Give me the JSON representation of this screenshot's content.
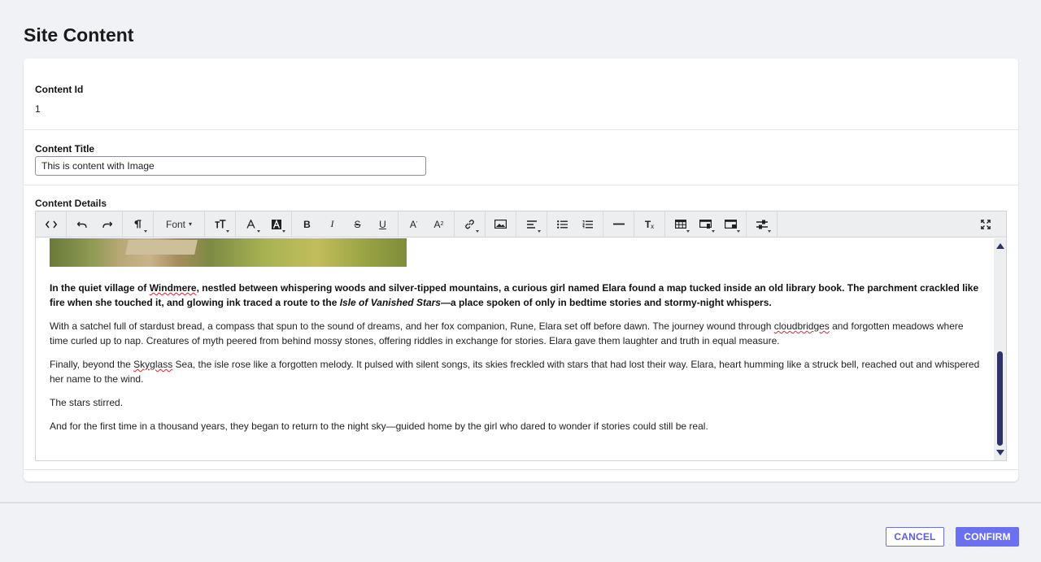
{
  "page": {
    "title": "Site Content"
  },
  "fields": {
    "content_id": {
      "label": "Content Id",
      "value": "1"
    },
    "content_title": {
      "label": "Content Title",
      "value": "This is content with Image"
    },
    "content_details": {
      "label": "Content Details"
    }
  },
  "toolbar": {
    "font_label": "Font",
    "items": [
      "code-view-icon",
      "undo-icon",
      "redo-icon",
      "paragraph-icon",
      "font-dropdown",
      "font-size-icon",
      "font-color-icon",
      "highlight-color-icon",
      "bold-icon",
      "italic-icon",
      "strikethrough-icon",
      "underline-icon",
      "superscript-icon",
      "subscript-icon",
      "link-icon",
      "image-icon",
      "align-icon",
      "bullet-list-icon",
      "numbered-list-icon",
      "horizontal-rule-icon",
      "clear-format-icon",
      "table-icon",
      "image-style-icon",
      "video-icon",
      "settings-icon",
      "fullscreen-icon"
    ]
  },
  "story": {
    "p1": {
      "t1": "In the quiet village of ",
      "w1": "Windmere",
      "t2": ", nestled between whispering woods and silver-tipped mountains, a curious girl named Elara found a map tucked inside an old library book. The parchment crackled like fire when she touched it, and glowing ink traced a route to the ",
      "em": "Isle of Vanished Stars",
      "t3": "—a place spoken of only in bedtime stories and stormy-night whispers."
    },
    "p2": {
      "t1": "With a satchel full of stardust bread, a compass that spun to the sound of dreams, and her fox companion, Rune, Elara set off before dawn. The journey wound through ",
      "w1": "cloudbridges",
      "t2": " and forgotten meadows where time curled up to nap. Creatures of myth peered from behind mossy stones, offering riddles in exchange for stories. Elara gave them laughter and truth in equal measure."
    },
    "p3": {
      "t1": "Finally, beyond the ",
      "w1": "Skyglass",
      "t2": " Sea, the isle rose like a forgotten melody. It pulsed with silent songs, its skies freckled with stars that had lost their way. Elara, heart humming like a struck bell, reached out and whispered her name to the wind."
    },
    "p4": "The stars stirred.",
    "p5": "And for the first time in a thousand years, they began to return to the night sky—guided home by the girl who dared to wonder if stories could still be real."
  },
  "actions": {
    "cancel": "CANCEL",
    "confirm": "CONFIRM"
  },
  "colors": {
    "accent": "#6b70ee",
    "scrollbar": "#2d3367",
    "spellcheck": "#d22233"
  }
}
